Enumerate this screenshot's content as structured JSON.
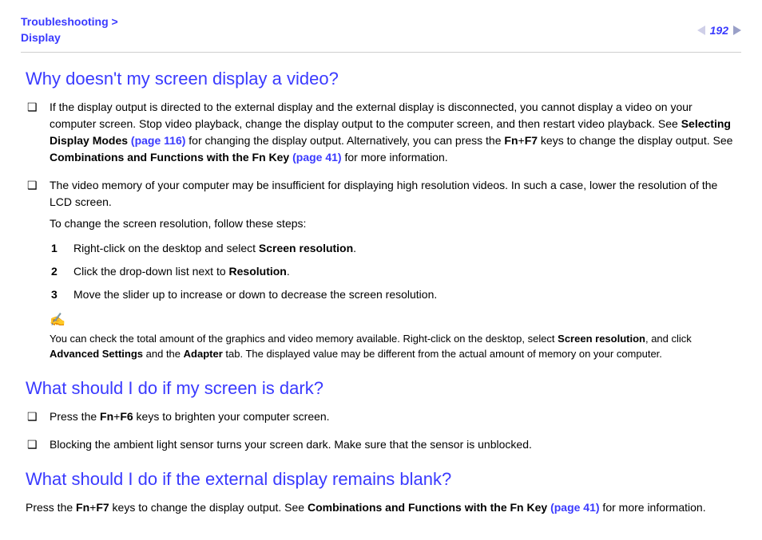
{
  "header": {
    "crumb1": "Troubleshooting",
    "sep": " > ",
    "crumb2": "Display",
    "page": "192"
  },
  "s1": {
    "heading": "Why doesn't my screen display a video?",
    "b1_a": "If the display output is directed to the external display and the external display is disconnected, you cannot display a video on your computer screen. Stop video playback, change the display output to the computer screen, and then restart video playback. See ",
    "b1_ref1": "Selecting Display Modes ",
    "b1_pg1": "(page 116)",
    "b1_b": " for changing the display output. Alternatively, you can press the ",
    "b1_fn": "Fn",
    "b1_plus": "+",
    "b1_f7": "F7",
    "b1_c": " keys to change the display output. See ",
    "b1_ref2": "Combinations and Functions with the Fn Key ",
    "b1_pg2": "(page 41)",
    "b1_d": " for more information.",
    "b2_a": "The video memory of your computer may be insufficient for displaying high resolution videos. In such a case, lower the resolution of the LCD screen.",
    "b2_sub": "To change the screen resolution, follow these steps:",
    "step1_a": "Right-click on the desktop and select ",
    "step1_b": "Screen resolution",
    "step1_c": ".",
    "step2_a": "Click the drop-down list next to ",
    "step2_b": "Resolution",
    "step2_c": ".",
    "step3": "Move the slider up to increase or down to decrease the screen resolution.",
    "note_icon": "✍",
    "note_a": "You can check the total amount of the graphics and video memory available. Right-click on the desktop, select ",
    "note_b": "Screen resolution",
    "note_c": ", and click ",
    "note_d": "Advanced Settings",
    "note_e": " and the ",
    "note_f": "Adapter",
    "note_g": " tab. The displayed value may be different from the actual amount of memory on your computer.",
    "n1": "1",
    "n2": "2",
    "n3": "3"
  },
  "s2": {
    "heading": "What should I do if my screen is dark?",
    "b1_a": "Press the ",
    "b1_fn": "Fn",
    "b1_plus": "+",
    "b1_f6": "F6",
    "b1_b": " keys to brighten your computer screen.",
    "b2": "Blocking the ambient light sensor turns your screen dark. Make sure that the sensor is unblocked."
  },
  "s3": {
    "heading": "What should I do if the external display remains blank?",
    "p_a": "Press the ",
    "p_fn": "Fn",
    "p_plus": "+",
    "p_f7": "F7",
    "p_b": " keys to change the display output. See ",
    "p_ref": "Combinations and Functions with the Fn Key ",
    "p_pg": "(page 41)",
    "p_c": " for more information."
  }
}
